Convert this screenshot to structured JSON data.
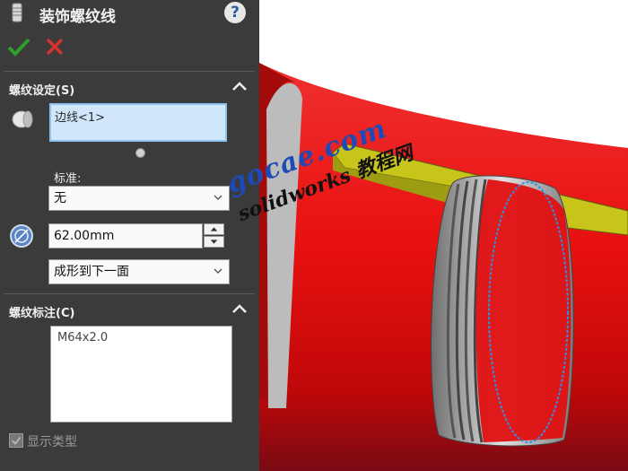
{
  "panel": {
    "title": "装饰螺纹线",
    "help_label": "?",
    "thread_settings": {
      "title": "螺纹设定(S)",
      "edge_value": "边线<1>",
      "standard_label": "标准:",
      "standard_value": "无",
      "diameter_value": "62.00mm",
      "end_condition": "成形到下一面"
    },
    "thread_callout": {
      "title": "螺纹标注(C)",
      "value": "M64x2.0"
    },
    "show_type_label": "显示类型"
  },
  "watermark": {
    "line1": "gocae.com",
    "line2": "solidworks 教程网"
  },
  "colors": {
    "panel_bg": "#3b3b3b",
    "selection_box": "#cfe6fb",
    "part_red": "#e01010",
    "thread_highlight": "#2f8fe8",
    "slot_face": "#c7c51a"
  }
}
